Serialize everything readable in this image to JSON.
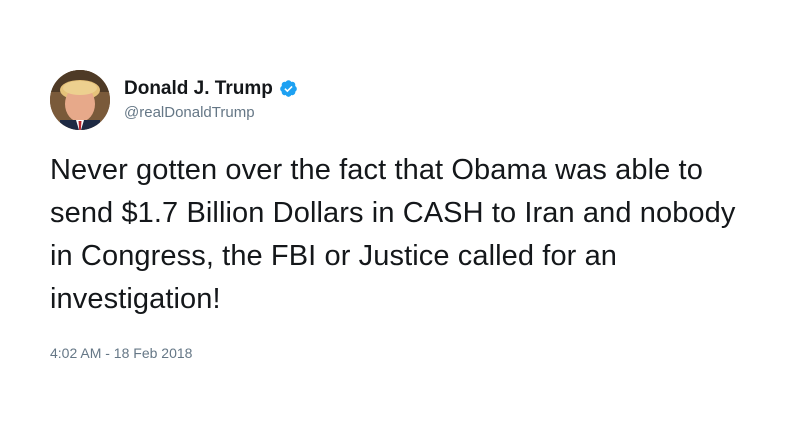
{
  "tweet": {
    "display_name": "Donald J. Trump",
    "handle": "@realDonaldTrump",
    "verified": true,
    "text": "Never gotten over the fact that Obama was able to send $1.7 Billion Dollars in CASH to Iran and nobody in Congress, the FBI or Justice called for an investigation!",
    "timestamp": "4:02 AM - 18 Feb 2018"
  },
  "icons": {
    "verified": "verified-badge-icon",
    "avatar": "profile-photo"
  },
  "colors": {
    "verified_blue": "#1da1f2",
    "secondary_text": "#657786",
    "primary_text": "#14171a"
  }
}
